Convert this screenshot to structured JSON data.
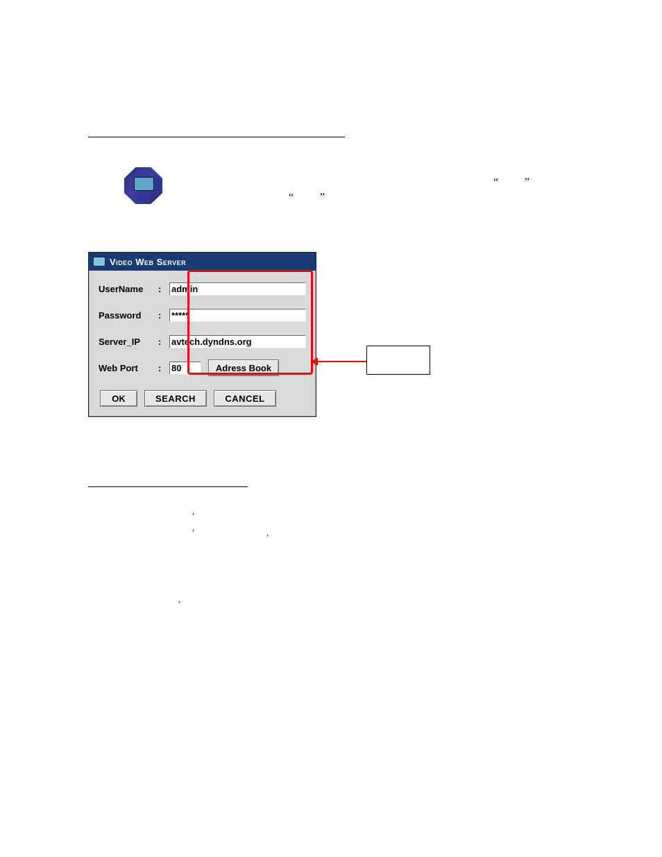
{
  "dialog": {
    "title": "Video Web Server",
    "fields": {
      "username_label": "UserName",
      "username_value": "admin",
      "password_label": "Password",
      "password_value": "*****",
      "serverip_label": "Server_IP",
      "serverip_value": "avtech.dyndns.org",
      "webport_label": "Web Port",
      "webport_value": "80"
    },
    "buttons": {
      "address_book": "Adress Book",
      "ok": "OK",
      "search": "SEARCH",
      "cancel": "CANCEL"
    }
  },
  "callout": {
    "label": ""
  },
  "quotes": {
    "q1_open": "“",
    "q1_close": "”",
    "q2_open": "“",
    "q2_close": "”"
  },
  "marks": {
    "m1": ",",
    "m2": ",",
    "m3": ",",
    "m4": ","
  }
}
